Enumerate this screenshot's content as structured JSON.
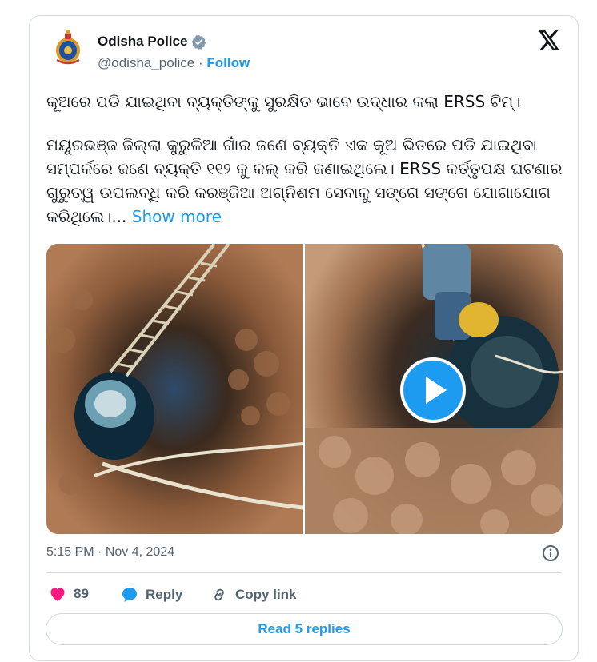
{
  "author": {
    "name": "Odisha Police",
    "handle": "@odisha_police",
    "separator": "·",
    "follow_label": "Follow",
    "verified_icon": "verified-badge-icon",
    "avatar_icon": "police-emblem-icon"
  },
  "brand_logo": "x-logo-icon",
  "tweet": {
    "headline": "କୂଅରେ ପଡି ଯାଇଥିବା ବ୍ୟକ୍ତିଙ୍କୁ ସୁରକ୍ଷିତ ଭାବେ ଉଦ୍ଧାର କଲା ERSS ଟିମ୍।",
    "body": " ମୟୂରଭଞ୍ଜ ଜିଲ୍ଲା କୁରୁଳିଆ ଗାଁର ଜଣେ ବ୍ୟକ୍ତି ଏକ କୂଅ ଭିତରେ ପଡି ଯାଇଥିବା ସମ୍ପର୍କରେ ଜଣେ ବ୍ୟକ୍ତି ୧୧୨ କୁ କଲ୍ କରି ଜଣାଇଥିଲେ। ERSS କର୍ତ୍ତୃପକ୍ଷ ଘଟଣାର ଗୁରୁତ୍ୱ ଉପଲବ୍ଧି କରି କରଞ୍ଜିଆ ଅଗ୍ନିଶମ ସେବାକୁ ସଙ୍ଗେ ସଙ୍ଗେ ଯୋଗାଯୋଗ କରିଥିଲେ।...",
    "show_more": "Show more"
  },
  "media": {
    "play_icon": "play-button-icon",
    "images": [
      "well-rescue-image-left",
      "well-rescue-image-right"
    ]
  },
  "meta": {
    "time": "5:15 PM",
    "separator": "·",
    "date": "Nov 4, 2024",
    "info_icon": "info-icon"
  },
  "actions": {
    "like_count": "89",
    "reply_label": "Reply",
    "copy_link_label": "Copy link"
  },
  "read_replies": "Read 5 replies",
  "colors": {
    "accent": "#1d9bf0",
    "like": "#f91880",
    "text": "#0f1419",
    "muted": "#536471",
    "border": "#cfd9de"
  }
}
